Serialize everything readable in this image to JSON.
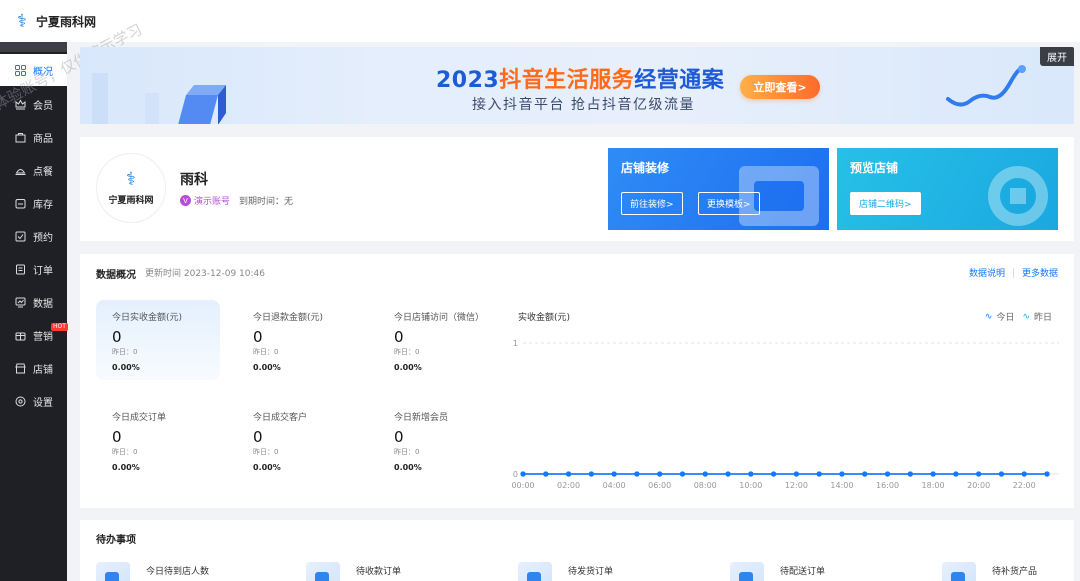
{
  "app": {
    "logo_icon": "dna-logo-icon",
    "name": "宁夏雨科网"
  },
  "sidebar": {
    "items": [
      {
        "label": "概况",
        "icon": "dashboard-icon",
        "active": true
      },
      {
        "label": "会员",
        "icon": "crown-icon"
      },
      {
        "label": "商品",
        "icon": "product-icon"
      },
      {
        "label": "点餐",
        "icon": "dish-icon"
      },
      {
        "label": "库存",
        "icon": "inventory-icon"
      },
      {
        "label": "预约",
        "icon": "calendar-check-icon"
      },
      {
        "label": "订单",
        "icon": "order-icon"
      },
      {
        "label": "数据",
        "icon": "chart-icon"
      },
      {
        "label": "营销",
        "icon": "marketing-icon",
        "badge": "HOT"
      },
      {
        "label": "店铺",
        "icon": "store-icon"
      },
      {
        "label": "设置",
        "icon": "settings-icon"
      }
    ]
  },
  "watermark": "体验账号，仅供演示学习",
  "banner": {
    "title_year": "2023",
    "title_highlight": "抖音生活服务",
    "title_rest": "经营通案",
    "subtitle": "接入抖音平台 抢占抖音亿级流量",
    "cta": "立即查看>",
    "expand": "展开"
  },
  "store": {
    "logo_text": "宁夏雨科网",
    "name": "雨科",
    "demo_badge": "演示账号",
    "expire_label": "到期时间：无",
    "cards": [
      {
        "title": "店铺装修",
        "buttons": [
          "前往装修>",
          "更换模板>"
        ]
      },
      {
        "title": "预览店铺",
        "buttons": [
          "店铺二维码>"
        ]
      }
    ]
  },
  "overview": {
    "title": "数据概况",
    "updated": "更新时间 2023-12-09 10:46",
    "links": [
      "数据说明",
      "更多数据"
    ],
    "stats": [
      {
        "label": "今日实收金额(元)",
        "value": "0",
        "yesterday": "昨日：0",
        "pct": "0.00%"
      },
      {
        "label": "今日退款金额(元)",
        "value": "0",
        "yesterday": "昨日：0",
        "pct": "0.00%"
      },
      {
        "label": "今日店铺访问（微信）",
        "value": "0",
        "yesterday": "昨日：0",
        "pct": "0.00%"
      },
      {
        "label": "今日成交订单",
        "value": "0",
        "yesterday": "昨日：0",
        "pct": "0.00%"
      },
      {
        "label": "今日成交客户",
        "value": "0",
        "yesterday": "昨日：0",
        "pct": "0.00%"
      },
      {
        "label": "今日新增会员",
        "value": "0",
        "yesterday": "昨日：0",
        "pct": "0.00%"
      }
    ],
    "chart_title": "实收金额(元)",
    "legend": [
      "今日",
      "昨日"
    ]
  },
  "chart_data": {
    "type": "line",
    "title": "实收金额(元)",
    "x": [
      "00:00",
      "01:00",
      "02:00",
      "03:00",
      "04:00",
      "05:00",
      "06:00",
      "07:00",
      "08:00",
      "09:00",
      "10:00",
      "11:00",
      "12:00",
      "13:00",
      "14:00",
      "15:00",
      "16:00",
      "17:00",
      "18:00",
      "19:00",
      "20:00",
      "21:00",
      "22:00",
      "23:00"
    ],
    "tick_labels": [
      "00:00",
      "02:00",
      "04:00",
      "06:00",
      "08:00",
      "10:00",
      "12:00",
      "14:00",
      "16:00",
      "18:00",
      "20:00",
      "22:00"
    ],
    "series": [
      {
        "name": "今日",
        "values": [
          0,
          0,
          0,
          0,
          0,
          0,
          0,
          0,
          0,
          0,
          0,
          0,
          0,
          0,
          0,
          0,
          0,
          0,
          0,
          0,
          0,
          0,
          0,
          0
        ],
        "color": "#1677ff"
      },
      {
        "name": "昨日",
        "values": [
          0,
          0,
          0,
          0,
          0,
          0,
          0,
          0,
          0,
          0,
          0,
          0,
          0,
          0,
          0,
          0,
          0,
          0,
          0,
          0,
          0,
          0,
          0,
          0
        ],
        "color": "#27a8e0"
      }
    ],
    "ylim": [
      0,
      1
    ],
    "yticks": [
      "0",
      "1"
    ],
    "grid": true,
    "legend_position": "top-right"
  },
  "todo": {
    "title": "待办事项",
    "items": [
      "今日待到店人数",
      "待收款订单",
      "待发货订单",
      "待配送订单",
      "待补货产品"
    ]
  }
}
